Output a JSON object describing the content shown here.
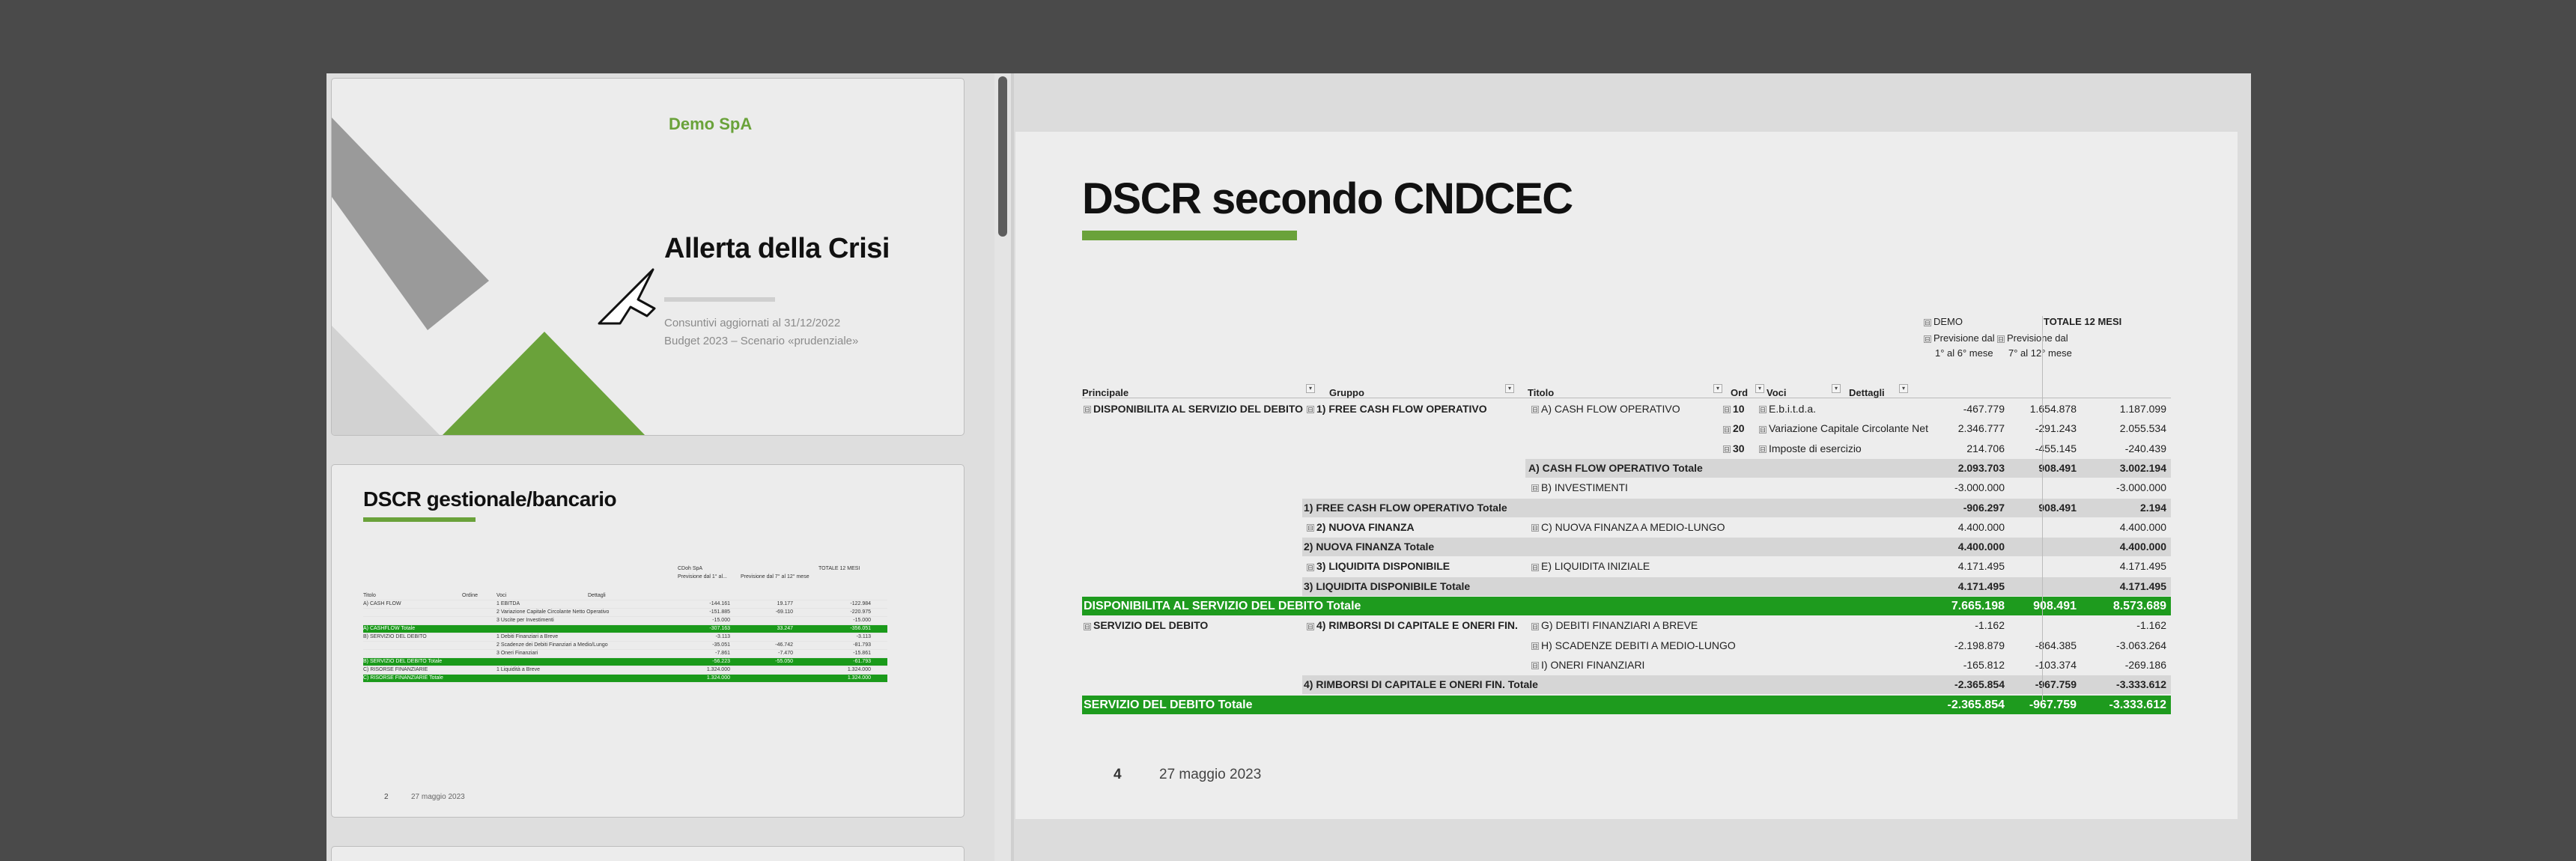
{
  "thumbnails": {
    "slide1": {
      "company": "Demo SpA",
      "title": "Allerta della Crisi",
      "subtitle1": "Consuntivi aggiornati al 31/12/2022",
      "subtitle2": "Budget 2023 – Scenario «prudenziale»"
    },
    "slide2": {
      "title": "DSCR gestionale/bancario",
      "page": "2",
      "date": "27 maggio 2023",
      "header": {
        "company": "CDoh SpA",
        "col1": "Previsione dal 1° al...",
        "col2": "Previsione dal 7° al 12° mese",
        "total": "TOTALE 12 MESI",
        "titolo": "Titolo",
        "ordine": "Ordine",
        "voci": "Voci",
        "dettagli": "Dettagli"
      },
      "rows": [
        {
          "a": "A) CASH FLOW",
          "b": "1 EBITDA",
          "c": "-144.161",
          "d": "19.177",
          "e": "-122.984",
          "green": false
        },
        {
          "a": "",
          "b": "2 Variazione Capitale Circolante Netto Operativo",
          "c": "-151.885",
          "d": "-69.110",
          "e": "-220.975",
          "green": false
        },
        {
          "a": "",
          "b": "3 Uscite per Investimenti",
          "c": "-15.000",
          "d": "",
          "e": "-15.000",
          "green": false
        },
        {
          "a": "A) CASHFLOW Totale",
          "b": "",
          "c": "-307.163",
          "d": "33.247",
          "e": "-356.051",
          "green": true
        },
        {
          "a": "B) SERVIZIO DEL DEBITO",
          "b": "1 Debiti Finanziari a Breve",
          "c": "-3.113",
          "d": "",
          "e": "-3.113",
          "green": false
        },
        {
          "a": "",
          "b": "2 Scadenze dei Debiti Finanziari a Medio/Lungo",
          "c": "-35.051",
          "d": "-46.742",
          "e": "-81.793",
          "green": false
        },
        {
          "a": "",
          "b": "3 Oneri Finanziari",
          "c": "-7.861",
          "d": "-7.470",
          "e": "-15.861",
          "green": false
        },
        {
          "a": "B) SERVIZIO DEL DEBITO Totale",
          "b": "",
          "c": "-56.223",
          "d": "-55.050",
          "e": "-61.793",
          "green": true
        },
        {
          "a": "C) RISORSE FINANZIARIE",
          "b": "1 Liquidità a Breve",
          "c": "1.324.000",
          "d": "",
          "e": "1.324.000",
          "green": false
        },
        {
          "a": "C) RISORSE FINANZIARIE Totale",
          "b": "",
          "c": "1.324.000",
          "d": "",
          "e": "1.324.000",
          "green": true
        }
      ]
    }
  },
  "slide": {
    "title": "DSCR secondo CNDCEC",
    "page": "4",
    "date": "27 maggio 2023",
    "pivot": {
      "company": "DEMO",
      "col1": [
        "Previsione dal",
        "1° al 6° mese"
      ],
      "col2": [
        "Previsione dal",
        "7° al 12° mese"
      ],
      "total": "TOTALE 12 MESI",
      "headers": {
        "principale": "Principale",
        "gruppo": "Gruppo",
        "titolo": "Titolo",
        "ord": "Ord",
        "voci": "Voci",
        "dettagli": "Dettagli"
      },
      "rows": [
        {
          "principale": "DISPONIBILITA AL SERVIZIO DEL DEBITO",
          "gruppo": "1) FREE CASH FLOW OPERATIVO",
          "titolo": "A) CASH FLOW OPERATIVO",
          "ord": "10",
          "voce": "E.b.i.t.d.a.",
          "v1": "-467.779",
          "v2": "1.654.878",
          "tot": "1.187.099",
          "style": ""
        },
        {
          "principale": "",
          "gruppo": "",
          "titolo": "",
          "ord": "20",
          "voce": "Variazione Capitale Circolante Net",
          "v1": "2.346.777",
          "v2": "-291.243",
          "tot": "2.055.534",
          "style": ""
        },
        {
          "principale": "",
          "gruppo": "",
          "titolo": "",
          "ord": "30",
          "voce": "Imposte di esercizio",
          "v1": "214.706",
          "v2": "-455.145",
          "tot": "-240.439",
          "style": ""
        },
        {
          "principale": "",
          "gruppo": "",
          "titolo": "A) CASH FLOW OPERATIVO Totale",
          "ord": "",
          "voce": "",
          "v1": "2.093.703",
          "v2": "908.491",
          "tot": "3.002.194",
          "style": "sub-total-titolo"
        },
        {
          "principale": "",
          "gruppo": "",
          "titolo": "B) INVESTIMENTI",
          "ord": "",
          "voce": "",
          "v1": "-3.000.000",
          "v2": "",
          "tot": "-3.000.000",
          "style": ""
        },
        {
          "principale": "",
          "gruppo": "1) FREE CASH FLOW OPERATIVO Totale",
          "titolo": "",
          "ord": "",
          "voce": "",
          "v1": "-906.297",
          "v2": "908.491",
          "tot": "2.194",
          "style": "sub-total"
        },
        {
          "principale": "",
          "gruppo": "2) NUOVA FINANZA",
          "titolo": "C) NUOVA FINANZA A MEDIO-LUNGO",
          "ord": "",
          "voce": "",
          "v1": "4.400.000",
          "v2": "",
          "tot": "4.400.000",
          "style": ""
        },
        {
          "principale": "",
          "gruppo": "2) NUOVA FINANZA Totale",
          "titolo": "",
          "ord": "",
          "voce": "",
          "v1": "4.400.000",
          "v2": "",
          "tot": "4.400.000",
          "style": "sub-total"
        },
        {
          "principale": "",
          "gruppo": "3)  LIQUIDITA DISPONIBILE",
          "titolo": "E)  LIQUIDITA INIZIALE",
          "ord": "",
          "voce": "",
          "v1": "4.171.495",
          "v2": "",
          "tot": "4.171.495",
          "style": ""
        },
        {
          "principale": "",
          "gruppo": "3)  LIQUIDITA DISPONIBILE Totale",
          "titolo": "",
          "ord": "",
          "voce": "",
          "v1": "4.171.495",
          "v2": "",
          "tot": "4.171.495",
          "style": "sub-total"
        },
        {
          "principale": "DISPONIBILITA AL SERVIZIO DEL DEBITO Totale",
          "gruppo": "",
          "titolo": "",
          "ord": "",
          "voce": "",
          "v1": "7.665.198",
          "v2": "908.491",
          "tot": "8.573.689",
          "style": "green"
        },
        {
          "principale": "SERVIZIO DEL DEBITO",
          "gruppo": "4) RIMBORSI DI CAPITALE E ONERI FIN.",
          "titolo": "G)  DEBITI FINANZIARI A BREVE",
          "ord": "",
          "voce": "",
          "v1": "-1.162",
          "v2": "",
          "tot": "-1.162",
          "style": ""
        },
        {
          "principale": "",
          "gruppo": "",
          "titolo": "H) SCADENZE DEBITI A MEDIO-LUNGO",
          "ord": "",
          "voce": "",
          "v1": "-2.198.879",
          "v2": "-864.385",
          "tot": "-3.063.264",
          "style": ""
        },
        {
          "principale": "",
          "gruppo": "",
          "titolo": "I) ONERI FINANZIARI",
          "ord": "",
          "voce": "",
          "v1": "-165.812",
          "v2": "-103.374",
          "tot": "-269.186",
          "style": ""
        },
        {
          "principale": "",
          "gruppo": "4) RIMBORSI DI CAPITALE E ONERI FIN. Totale",
          "titolo": "",
          "ord": "",
          "voce": "",
          "v1": "-2.365.854",
          "v2": "-967.759",
          "tot": "-3.333.612",
          "style": "sub-total"
        },
        {
          "principale": "SERVIZIO DEL DEBITO Totale",
          "gruppo": "",
          "titolo": "",
          "ord": "",
          "voce": "",
          "v1": "-2.365.854",
          "v2": "-967.759",
          "tot": "-3.333.612",
          "style": "green"
        }
      ]
    }
  },
  "colors": {
    "accent_green": "#6aa23a",
    "total_green": "#1e9b1e"
  }
}
